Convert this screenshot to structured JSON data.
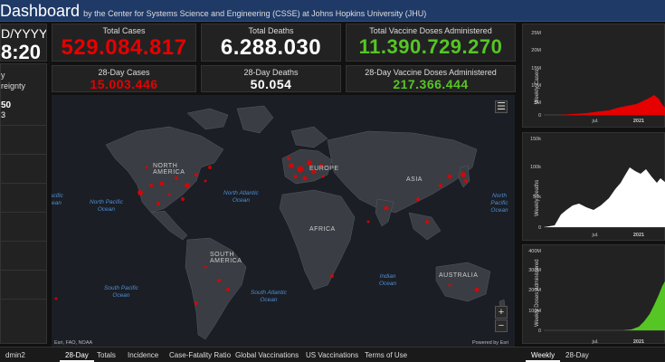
{
  "header": {
    "title": "Dashboard",
    "subtitle": "by the Center for Systems Science and Engineering (CSSE) at Johns Hopkins University (JHU)"
  },
  "left": {
    "date_format": "D/YYYY)",
    "time": "8:20",
    "list_header": [
      "y",
      "reignty"
    ],
    "items": [
      "50",
      "3",
      "",
      "",
      "",
      "",
      ""
    ],
    "footer": "dmin2"
  },
  "stats": {
    "total_cases": {
      "label": "Total Cases",
      "value": "529.084.817",
      "color": "#e60000"
    },
    "total_deaths": {
      "label": "Total Deaths",
      "value": "6.288.030",
      "color": "#ffffff"
    },
    "total_vaccine": {
      "label": "Total Vaccine Doses Administered",
      "value": "11.390.729.270",
      "color": "#55c624"
    },
    "cases_28": {
      "label": "28-Day Cases",
      "value": "15.003.446",
      "color": "#e60000"
    },
    "deaths_28": {
      "label": "28-Day Deaths",
      "value": "50.054",
      "color": "#ffffff"
    },
    "vaccine_28": {
      "label": "28-Day Vaccine Doses Administered",
      "value": "217.366.444",
      "color": "#55c624"
    }
  },
  "map": {
    "continents": [
      "NORTH",
      "AMERICA",
      "EUROPE",
      "ASIA",
      "AFRICA",
      "SOUTH",
      "AMERICA",
      "AUSTRALIA"
    ],
    "oceans": [
      [
        "North Pacific",
        "Ocean"
      ],
      [
        "North Atlantic",
        "Ocean"
      ],
      [
        "South Pacific",
        "Ocean"
      ],
      [
        "South Atlantic",
        "Ocean"
      ],
      [
        "Indian",
        "Ocean"
      ],
      [
        "acific",
        "ean"
      ],
      [
        "North Pacific",
        "Ocean"
      ]
    ],
    "attribution": "Esri, FAO, NOAA",
    "powered": "Powered by Esri"
  },
  "bottom_tabs": [
    "28-Day",
    "Totals",
    "Incidence",
    "Case-Fatality Ratio",
    "Global Vaccinations",
    "US Vaccinations",
    "Terms of Use"
  ],
  "right_tabs": [
    "Weekly",
    "28-Day"
  ],
  "charts": [
    {
      "ylabel": "Weekly Cases",
      "ticks": [
        "25M",
        "20M",
        "15M",
        "10M",
        "5M",
        "0"
      ],
      "xticks": [
        "jul.",
        "2021"
      ],
      "color": "#e60000"
    },
    {
      "ylabel": "Weekly Deaths",
      "ticks": [
        "150k",
        "100k",
        "50k",
        "0"
      ],
      "xticks": [
        "jul.",
        "2021"
      ],
      "color": "#ffffff"
    },
    {
      "ylabel": "Weekly Doses Administered",
      "ticks": [
        "400M",
        "300M",
        "200M",
        "100M",
        "0"
      ],
      "xticks": [
        "jul.",
        "2021"
      ],
      "color": "#55c624"
    }
  ]
}
